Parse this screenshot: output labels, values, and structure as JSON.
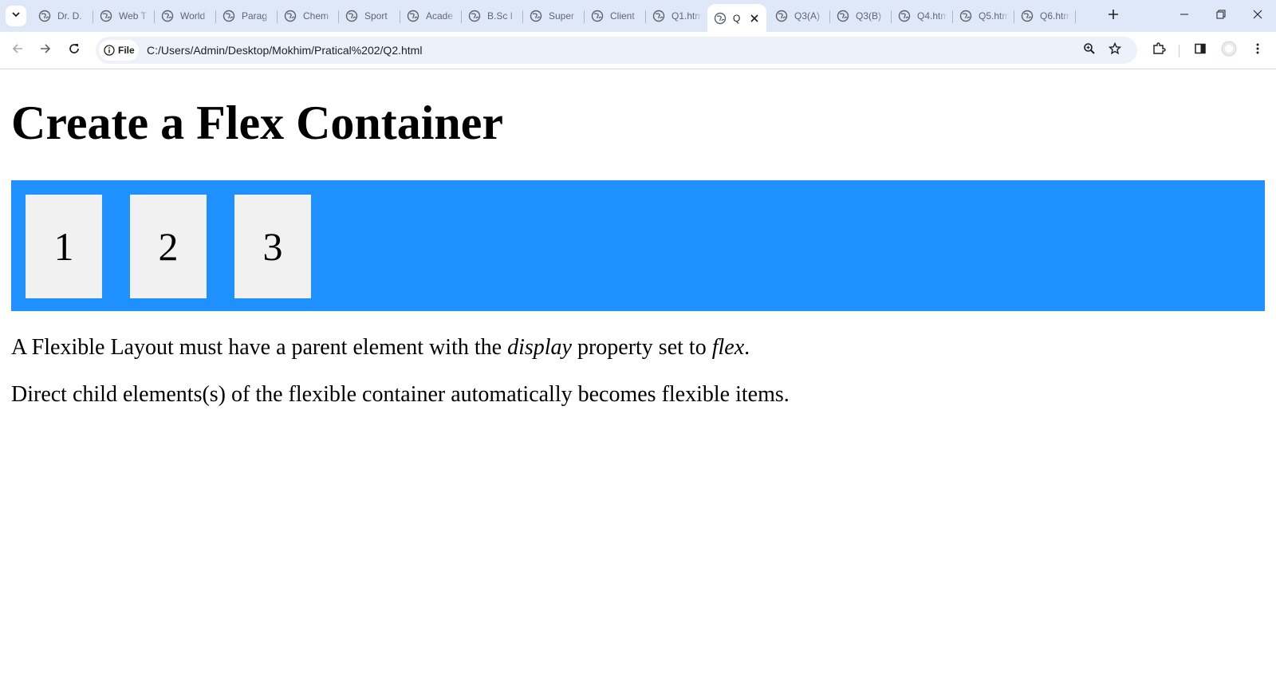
{
  "browser": {
    "tabs": [
      {
        "label": "Dr. D."
      },
      {
        "label": "Web T"
      },
      {
        "label": "World"
      },
      {
        "label": "Parag"
      },
      {
        "label": "Chem"
      },
      {
        "label": "Sport"
      },
      {
        "label": "Acade"
      },
      {
        "label": "B.Sc I"
      },
      {
        "label": "Super"
      },
      {
        "label": "Client"
      },
      {
        "label": "Q1.htm"
      },
      {
        "label": "Q",
        "active": true
      },
      {
        "label": "Q3(A)"
      },
      {
        "label": "Q3(B)"
      },
      {
        "label": "Q4.htm"
      },
      {
        "label": "Q5.htm"
      },
      {
        "label": "Q6.htm"
      }
    ],
    "omnibox": {
      "chip_label": "File",
      "url": "C:/Users/Admin/Desktop/Mokhim/Pratical%202/Q2.html"
    },
    "colors": {
      "tabbar": "#dfe8f8",
      "omnibox": "#edf2fa"
    }
  },
  "page": {
    "heading": "Create a Flex Container",
    "flex_items": [
      "1",
      "2",
      "3"
    ],
    "paragraph1": {
      "part1": "A Flexible Layout must have a parent element with the ",
      "em1": "display",
      "part2": " property set to ",
      "em2": "flex",
      "part3": "."
    },
    "paragraph2": "Direct child elements(s) of the flexible container automatically becomes flexible items.",
    "colors": {
      "container": "#1e90ff",
      "item": "#f1f1f1"
    }
  }
}
